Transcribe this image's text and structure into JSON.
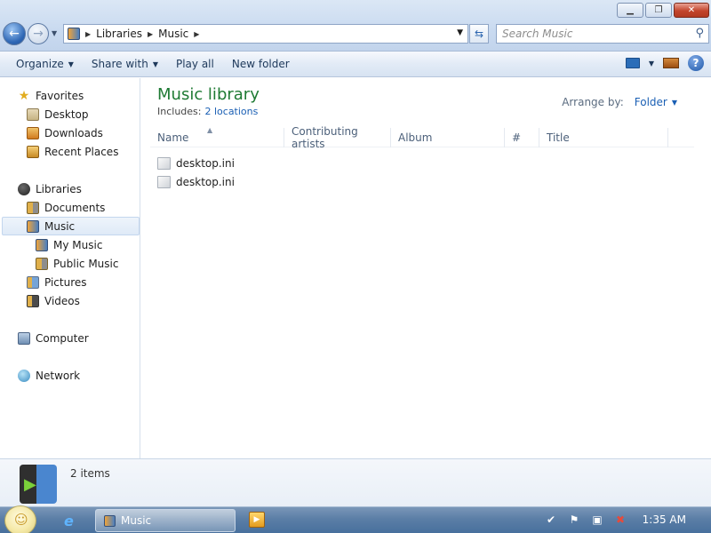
{
  "address": {
    "crumbs": [
      "Libraries",
      "Music"
    ],
    "search_placeholder": "Search Music"
  },
  "toolbar": {
    "organize": "Organize",
    "share_with": "Share with",
    "play_all": "Play all",
    "new_folder": "New folder"
  },
  "nav": {
    "favorites": "Favorites",
    "desktop": "Desktop",
    "downloads": "Downloads",
    "recent_places": "Recent Places",
    "libraries": "Libraries",
    "documents": "Documents",
    "music": "Music",
    "my_music": "My Music",
    "public_music": "Public Music",
    "pictures": "Pictures",
    "videos": "Videos",
    "computer": "Computer",
    "network": "Network"
  },
  "library": {
    "title": "Music library",
    "includes_label": "Includes:",
    "includes_link": "2 locations",
    "arrange_label": "Arrange by:",
    "arrange_value": "Folder"
  },
  "columns": {
    "name": "Name",
    "artists": "Contributing artists",
    "album": "Album",
    "number": "#",
    "title": "Title"
  },
  "files": [
    "desktop.ini",
    "desktop.ini"
  ],
  "details": {
    "count": "2 items"
  },
  "taskbar": {
    "task_label": "Music",
    "clock": "1:35 AM"
  }
}
